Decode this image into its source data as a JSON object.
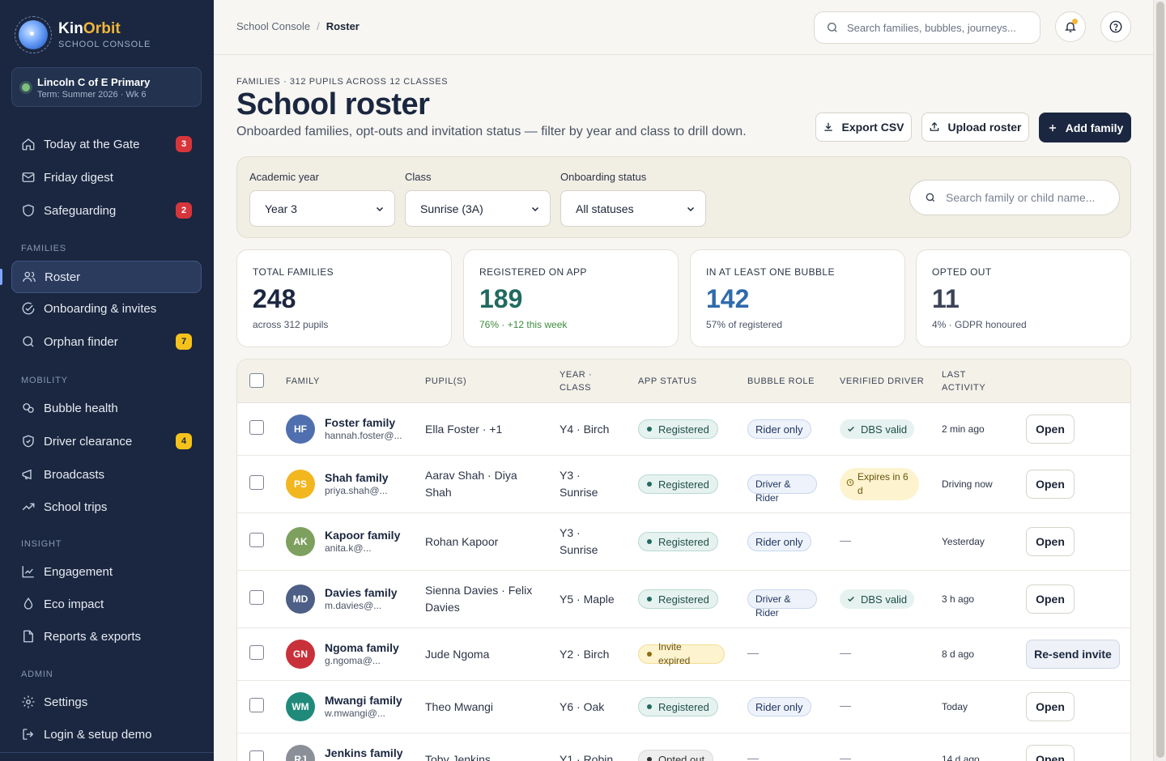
{
  "brand": {
    "name_main": "Kin",
    "name_accent": "Orbit",
    "subtitle": "SCHOOL CONSOLE"
  },
  "school": {
    "name": "Lincoln C of E Primary",
    "term": "Term: Summer 2026 · Wk 6"
  },
  "nav": {
    "items": [
      {
        "label": "Today at the Gate",
        "icon": "home-icon",
        "badge": "3"
      },
      {
        "label": "Friday digest",
        "icon": "mail-icon"
      },
      {
        "label": "Safeguarding",
        "icon": "shield-icon",
        "badge": "2"
      },
      {
        "label": "Roster",
        "icon": "users-icon",
        "active": true
      },
      {
        "label": "Onboarding & invites",
        "icon": "check-circle-icon"
      },
      {
        "label": "Orphan finder",
        "icon": "search-icon",
        "badge": "7"
      },
      {
        "label": "Bubble health",
        "icon": "bubbles-icon"
      },
      {
        "label": "Driver clearance",
        "icon": "shield-check-icon",
        "badge": "4"
      },
      {
        "label": "Broadcasts",
        "icon": "megaphone-icon"
      },
      {
        "label": "School trips",
        "icon": "trend-icon"
      },
      {
        "label": "Engagement",
        "icon": "chart-line-icon"
      },
      {
        "label": "Eco impact",
        "icon": "leaf-drop-icon"
      },
      {
        "label": "Reports & exports",
        "icon": "file-icon"
      },
      {
        "label": "Settings",
        "icon": "gear-icon"
      },
      {
        "label": "Login & setup demo",
        "icon": "login-icon"
      }
    ],
    "sections": {
      "families": "FAMILIES",
      "mobility": "MOBILITY",
      "insight": "INSIGHT",
      "admin": "ADMIN"
    }
  },
  "topbar": {
    "breadcrumb_root": "School Console",
    "breadcrumb_sep": "/",
    "breadcrumb_current": "Roster",
    "search_placeholder": "Search families, bubbles, journeys..."
  },
  "header": {
    "eyebrow": "FAMILIES · 312 PUPILS ACROSS 12 CLASSES",
    "title": "School roster",
    "description": "Onboarded families, opt-outs and invitation status — filter by year and class to drill down.",
    "export_label": "Export CSV",
    "upload_label": "Upload roster",
    "add_label": "Add family"
  },
  "filters": {
    "year_label": "Academic year",
    "year_value": "Year 3",
    "class_label": "Class",
    "class_value": "Sunrise (3A)",
    "status_label": "Onboarding status",
    "status_value": "All statuses",
    "search_placeholder": "Search family or child name..."
  },
  "stats": [
    {
      "label": "TOTAL FAMILIES",
      "value": "248",
      "sub": "across 312 pupils",
      "color": "#1b2740",
      "sub_color": "#4a5365"
    },
    {
      "label": "REGISTERED ON APP",
      "value": "189",
      "sub": "76% · +12 this week",
      "color": "#216a60",
      "sub_color": "#3d8a3d"
    },
    {
      "label": "IN AT LEAST ONE BUBBLE",
      "value": "142",
      "sub": "57% of registered",
      "color": "#2f6bab",
      "sub_color": "#4a5365"
    },
    {
      "label": "OPTED OUT",
      "value": "11",
      "sub": "4% · GDPR honoured",
      "color": "#3c4557",
      "sub_color": "#4a5365"
    }
  ],
  "table": {
    "headers": {
      "family": "FAMILY",
      "pupils": "PUPIL(S)",
      "year_class": "YEAR ·\nCLASS",
      "app_status": "APP STATUS",
      "bubble_role": "BUBBLE ROLE",
      "verified_driver": "VERIFIED DRIVER",
      "last_activity": "LAST\nACTIVITY"
    },
    "rows": [
      {
        "initials": "HF",
        "avatar_color": "#4f6fae",
        "name": "Foster family",
        "email": "hannah.foster@...",
        "pupils": "Ella Foster · +1",
        "year_class": "Y4 · Birch",
        "status": "Registered",
        "role": "Rider only",
        "driver": "DBS valid",
        "activity": "2 min ago",
        "action": "Open"
      },
      {
        "initials": "PS",
        "avatar_color": "#f2b61f",
        "name": "Shah family",
        "email": "priya.shah@...",
        "pupils": "Aarav Shah · Diya Shah",
        "year_class": "Y3 · Sunrise",
        "status": "Registered",
        "role": "Driver & Rider",
        "driver": "Expires in 6 d",
        "activity": "Driving now",
        "action": "Open"
      },
      {
        "initials": "AK",
        "avatar_color": "#7ea05f",
        "name": "Kapoor family",
        "email": "anita.k@...",
        "pupils": "Rohan Kapoor",
        "year_class": "Y3 · Sunrise",
        "status": "Registered",
        "role": "Rider only",
        "driver": "—",
        "activity": "Yesterday",
        "action": "Open"
      },
      {
        "initials": "MD",
        "avatar_color": "#4d5f86",
        "name": "Davies family",
        "email": "m.davies@...",
        "pupils": "Sienna Davies · Felix Davies",
        "year_class": "Y5 · Maple",
        "status": "Registered",
        "role": "Driver & Rider",
        "driver": "DBS valid",
        "activity": "3 h ago",
        "action": "Open"
      },
      {
        "initials": "GN",
        "avatar_color": "#c8313a",
        "name": "Ngoma family",
        "email": "g.ngoma@...",
        "pupils": "Jude Ngoma",
        "year_class": "Y2 · Birch",
        "status": "Invite expired",
        "role": "—",
        "driver": "—",
        "activity": "8 d ago",
        "action": "Re-send invite"
      },
      {
        "initials": "WM",
        "avatar_color": "#1f8a7a",
        "name": "Mwangi family",
        "email": "w.mwangi@...",
        "pupils": "Theo Mwangi",
        "year_class": "Y6 · Oak",
        "status": "Registered",
        "role": "Rider only",
        "driver": "—",
        "activity": "Today",
        "action": "Open"
      },
      {
        "initials": "RJ",
        "avatar_color": "#8a8f98",
        "name": "Jenkins family",
        "email": "",
        "pupils": "Toby Jenkins",
        "year_class": "Y1 · Robin",
        "status": "Opted out",
        "role": "—",
        "driver": "—",
        "activity": "14 d ago",
        "action": "Open"
      }
    ]
  }
}
